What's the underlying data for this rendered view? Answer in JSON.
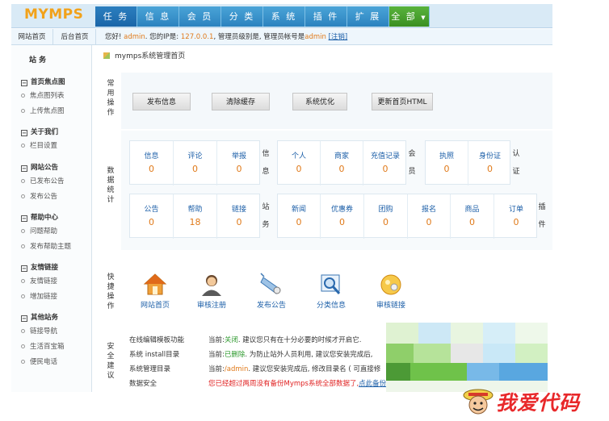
{
  "header": {
    "logo": "MYMPS",
    "nav": [
      "任 务",
      "信 息",
      "会 员",
      "分 类",
      "系 统",
      "插 件",
      "扩 展",
      "全 部"
    ]
  },
  "subbar": {
    "tab1": "网站首页",
    "tab2": "后台首页",
    "greet_prefix": "您好!",
    "greet_user": "admin",
    "greet_ip_label": ". 您的IP是:",
    "greet_ip": "127.0.0.1",
    "greet_mid": ", 管理员级别是, 管理员帐号是",
    "greet_account": "admin",
    "logout": "[注销]"
  },
  "sidebar": {
    "title": "站 务",
    "groups": [
      {
        "head": "首页焦点图",
        "items": [
          "焦点图列表",
          "上传焦点图"
        ]
      },
      {
        "head": "关于我们",
        "items": [
          "栏目设置"
        ]
      },
      {
        "head": "网站公告",
        "items": [
          "已发布公告",
          "发布公告"
        ]
      },
      {
        "head": "帮助中心",
        "items": [
          "问题帮助",
          "发布帮助主题"
        ]
      },
      {
        "head": "友情链接",
        "items": [
          "友情链接",
          "增加链接"
        ]
      },
      {
        "head": "其他站务",
        "items": [
          "链接导航",
          "生活百宝箱",
          "便民电话"
        ]
      }
    ]
  },
  "main": {
    "title": "mymps系统管理首页",
    "common_ops_label": "常用操作",
    "buttons": [
      "发布信息",
      "清除缓存",
      "系统优化",
      "更新首页HTML"
    ],
    "stats_label": "数据统计",
    "stats_row1": {
      "groups": [
        {
          "side": "信息",
          "cells": [
            {
              "label": "信息",
              "value": "0"
            },
            {
              "label": "评论",
              "value": "0"
            },
            {
              "label": "举报",
              "value": "0"
            }
          ]
        },
        {
          "side": "会员",
          "cells": [
            {
              "label": "个人",
              "value": "0"
            },
            {
              "label": "商家",
              "value": "0"
            },
            {
              "label": "充值记录",
              "value": "0"
            }
          ]
        },
        {
          "side": "认证",
          "cells": [
            {
              "label": "执照",
              "value": "0"
            },
            {
              "label": "身份证",
              "value": "0"
            }
          ]
        }
      ]
    },
    "stats_row2": {
      "groups": [
        {
          "side": "站务",
          "cells": [
            {
              "label": "公告",
              "value": "0"
            },
            {
              "label": "帮助",
              "value": "18"
            },
            {
              "label": "链接",
              "value": "0"
            }
          ]
        },
        {
          "side": "插件",
          "cells": [
            {
              "label": "新闻",
              "value": "0"
            },
            {
              "label": "优惠券",
              "value": "0"
            },
            {
              "label": "团购",
              "value": "0"
            },
            {
              "label": "报名",
              "value": "0"
            },
            {
              "label": "商品",
              "value": "0"
            },
            {
              "label": "订单",
              "value": "0"
            }
          ]
        }
      ]
    },
    "shortcut_label": "快捷操作",
    "shortcuts": [
      {
        "label": "网站首页",
        "icon": "home-icon"
      },
      {
        "label": "审核注册",
        "icon": "user-icon"
      },
      {
        "label": "发布公告",
        "icon": "announce-icon"
      },
      {
        "label": "分类信息",
        "icon": "magnifier-icon"
      },
      {
        "label": "审核链接",
        "icon": "link-icon"
      }
    ],
    "advice_label": "安全建议",
    "advice": [
      {
        "key": "在线编辑模板功能",
        "prefix": "当前:",
        "status": "关闭",
        "rest": ". 建议您只有在十分必要的时候才开启它."
      },
      {
        "key": "系统 install目录",
        "prefix": "当前:",
        "status": "已删除",
        "rest": ". 为防止站外人员利用, 建议您安装完成后,"
      },
      {
        "key": "系统管理目录",
        "prefix": "当前:",
        "status": "/admin",
        "rest": ". 建议您安装完成后, 修改目录名 ( 可直接修"
      },
      {
        "key": "数据安全",
        "warning": "您已经超过两周没有备份Mymps系统全部数据了,",
        "link": "点此备份"
      }
    ]
  },
  "watermark": {
    "text": "我爱代码"
  },
  "colors": {
    "accent_blue": "#2c82bf",
    "orange": "#e07a1a",
    "green": "#2f9a2f",
    "red": "#e02020",
    "link": "#1c5fa8"
  }
}
